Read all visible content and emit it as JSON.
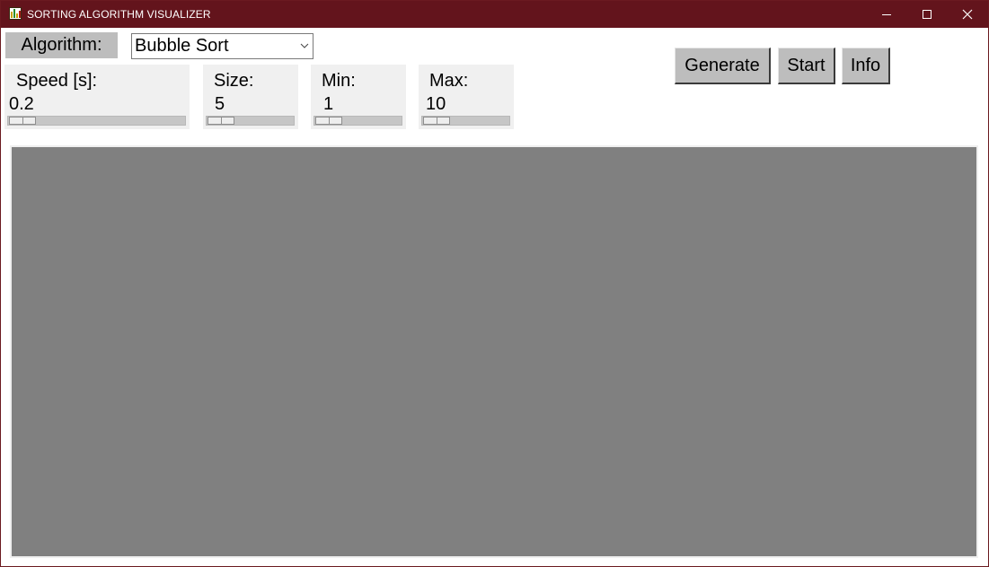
{
  "window": {
    "title": "SORTING ALGORITHM VISUALIZER",
    "colors": {
      "titlebar": "#63141c",
      "canvas": "#808080",
      "button": "#bdbdbd",
      "panel": "#f0f0f0"
    }
  },
  "controls": {
    "algorithm_label": "Algorithm:",
    "algorithm_selected": "Bubble Sort",
    "scales": {
      "speed": {
        "label": "Speed [s]:",
        "value": "0.2"
      },
      "size": {
        "label": "Size:",
        "value": "5"
      },
      "min": {
        "label": "Min:",
        "value": "1"
      },
      "max": {
        "label": "Max:",
        "value": "10"
      }
    }
  },
  "buttons": {
    "generate": "Generate",
    "start": "Start",
    "info": "Info"
  }
}
